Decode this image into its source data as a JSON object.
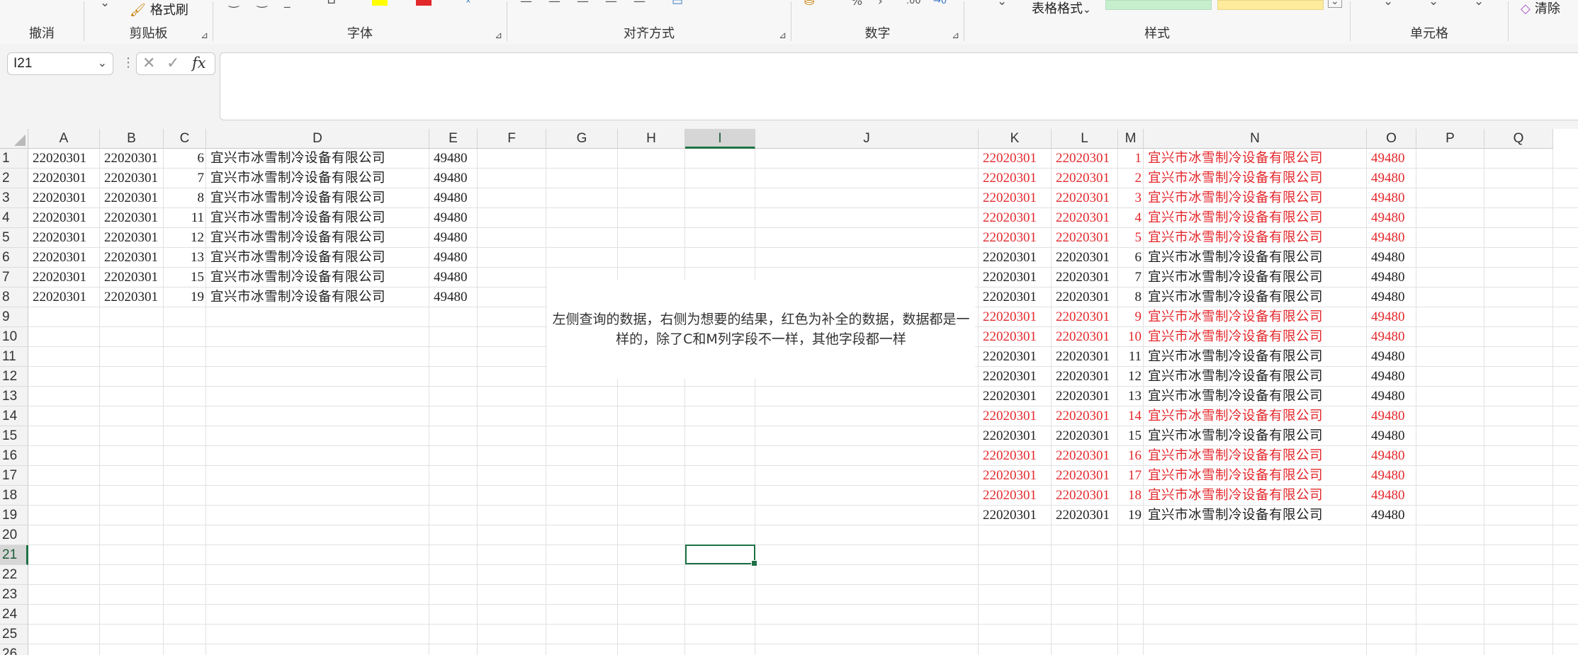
{
  "ribbon": {
    "groups": [
      {
        "label": "撤消"
      },
      {
        "label": "剪贴板"
      },
      {
        "label": "字体"
      },
      {
        "label": "对齐方式"
      },
      {
        "label": "数字"
      },
      {
        "label": "样式"
      },
      {
        "label": "单元格"
      }
    ],
    "format_painter": "格式刷",
    "table_format": "表格格式",
    "clear": "清除",
    "colors": {
      "highlight": "#ffff00",
      "font_color": "#e3282c",
      "style_good": "#c6efce",
      "style_neutral": "#ffeb9c"
    }
  },
  "formula_bar": {
    "name_box": "I21",
    "fx": "fx",
    "content": ""
  },
  "columns": [
    "A",
    "B",
    "C",
    "D",
    "E",
    "F",
    "G",
    "H",
    "I",
    "J",
    "K",
    "L",
    "M",
    "N",
    "O",
    "P",
    "Q"
  ],
  "selected_column": "I",
  "rows": [
    "1",
    "2",
    "3",
    "4",
    "5",
    "6",
    "7",
    "8",
    "9",
    "10",
    "11",
    "12",
    "13",
    "14",
    "15",
    "16",
    "17",
    "18",
    "19",
    "20",
    "21",
    "22",
    "23",
    "24",
    "25",
    "26"
  ],
  "selected_row": "21",
  "selected_cell": "I21",
  "left_table": [
    {
      "a": "22020301",
      "b": "22020301",
      "c": "6",
      "d": "宜兴市冰雪制冷设备有限公司",
      "e": "49480"
    },
    {
      "a": "22020301",
      "b": "22020301",
      "c": "7",
      "d": "宜兴市冰雪制冷设备有限公司",
      "e": "49480"
    },
    {
      "a": "22020301",
      "b": "22020301",
      "c": "8",
      "d": "宜兴市冰雪制冷设备有限公司",
      "e": "49480"
    },
    {
      "a": "22020301",
      "b": "22020301",
      "c": "11",
      "d": "宜兴市冰雪制冷设备有限公司",
      "e": "49480"
    },
    {
      "a": "22020301",
      "b": "22020301",
      "c": "12",
      "d": "宜兴市冰雪制冷设备有限公司",
      "e": "49480"
    },
    {
      "a": "22020301",
      "b": "22020301",
      "c": "13",
      "d": "宜兴市冰雪制冷设备有限公司",
      "e": "49480"
    },
    {
      "a": "22020301",
      "b": "22020301",
      "c": "15",
      "d": "宜兴市冰雪制冷设备有限公司",
      "e": "49480"
    },
    {
      "a": "22020301",
      "b": "22020301",
      "c": "19",
      "d": "宜兴市冰雪制冷设备有限公司",
      "e": "49480"
    }
  ],
  "right_table": [
    {
      "k": "22020301",
      "l": "22020301",
      "m": "1",
      "n": "宜兴市冰雪制冷设备有限公司",
      "o": "49480",
      "red": true
    },
    {
      "k": "22020301",
      "l": "22020301",
      "m": "2",
      "n": "宜兴市冰雪制冷设备有限公司",
      "o": "49480",
      "red": true
    },
    {
      "k": "22020301",
      "l": "22020301",
      "m": "3",
      "n": "宜兴市冰雪制冷设备有限公司",
      "o": "49480",
      "red": true
    },
    {
      "k": "22020301",
      "l": "22020301",
      "m": "4",
      "n": "宜兴市冰雪制冷设备有限公司",
      "o": "49480",
      "red": true
    },
    {
      "k": "22020301",
      "l": "22020301",
      "m": "5",
      "n": "宜兴市冰雪制冷设备有限公司",
      "o": "49480",
      "red": true
    },
    {
      "k": "22020301",
      "l": "22020301",
      "m": "6",
      "n": "宜兴市冰雪制冷设备有限公司",
      "o": "49480",
      "red": false
    },
    {
      "k": "22020301",
      "l": "22020301",
      "m": "7",
      "n": "宜兴市冰雪制冷设备有限公司",
      "o": "49480",
      "red": false
    },
    {
      "k": "22020301",
      "l": "22020301",
      "m": "8",
      "n": "宜兴市冰雪制冷设备有限公司",
      "o": "49480",
      "red": false
    },
    {
      "k": "22020301",
      "l": "22020301",
      "m": "9",
      "n": "宜兴市冰雪制冷设备有限公司",
      "o": "49480",
      "red": true
    },
    {
      "k": "22020301",
      "l": "22020301",
      "m": "10",
      "n": "宜兴市冰雪制冷设备有限公司",
      "o": "49480",
      "red": true
    },
    {
      "k": "22020301",
      "l": "22020301",
      "m": "11",
      "n": "宜兴市冰雪制冷设备有限公司",
      "o": "49480",
      "red": false
    },
    {
      "k": "22020301",
      "l": "22020301",
      "m": "12",
      "n": "宜兴市冰雪制冷设备有限公司",
      "o": "49480",
      "red": false
    },
    {
      "k": "22020301",
      "l": "22020301",
      "m": "13",
      "n": "宜兴市冰雪制冷设备有限公司",
      "o": "49480",
      "red": false
    },
    {
      "k": "22020301",
      "l": "22020301",
      "m": "14",
      "n": "宜兴市冰雪制冷设备有限公司",
      "o": "49480",
      "red": true
    },
    {
      "k": "22020301",
      "l": "22020301",
      "m": "15",
      "n": "宜兴市冰雪制冷设备有限公司",
      "o": "49480",
      "red": false
    },
    {
      "k": "22020301",
      "l": "22020301",
      "m": "16",
      "n": "宜兴市冰雪制冷设备有限公司",
      "o": "49480",
      "red": true
    },
    {
      "k": "22020301",
      "l": "22020301",
      "m": "17",
      "n": "宜兴市冰雪制冷设备有限公司",
      "o": "49480",
      "red": true
    },
    {
      "k": "22020301",
      "l": "22020301",
      "m": "18",
      "n": "宜兴市冰雪制冷设备有限公司",
      "o": "49480",
      "red": true
    },
    {
      "k": "22020301",
      "l": "22020301",
      "m": "19",
      "n": "宜兴市冰雪制冷设备有限公司",
      "o": "49480",
      "red": false
    }
  ],
  "note": "左侧查询的数据，右侧为想要的结果，红色为补全的数据，数据都是一样的，除了C和M列字段不一样，其他字段都一样"
}
